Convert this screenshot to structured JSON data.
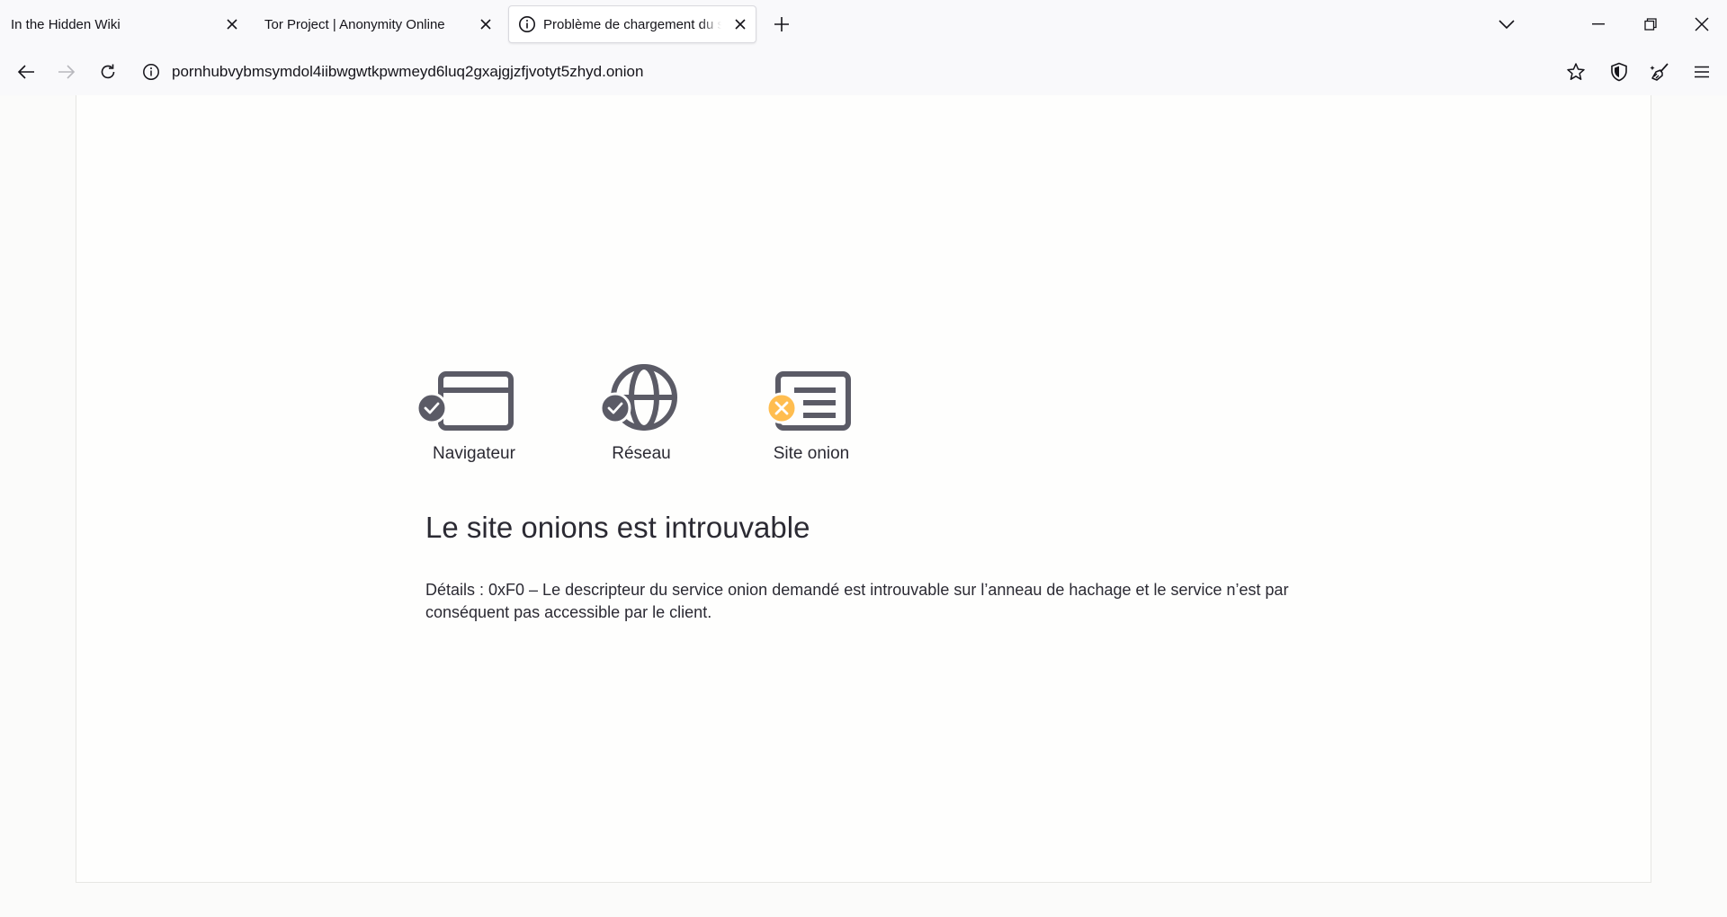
{
  "tabs": [
    {
      "title": "In the Hidden Wiki",
      "active": false
    },
    {
      "title": "Tor Project | Anonymity Online",
      "active": false
    },
    {
      "title": "Problème de chargement du site",
      "active": true
    }
  ],
  "navbar": {
    "url": "pornhubvybmsymdol4iibwgwtkpwmeyd6luq2gxajgjzfjvotyt5zhyd.onion"
  },
  "status_steps": [
    {
      "label": "Navigateur",
      "icon": "browser-icon",
      "status": "ok"
    },
    {
      "label": "Réseau",
      "icon": "globe-icon",
      "status": "ok"
    },
    {
      "label": "Site onion",
      "icon": "onion-site-icon",
      "status": "error"
    }
  ],
  "error": {
    "heading": "Le site onions est introuvable",
    "details": "Détails : 0xF0 – Le descripteur du service onion demandé est introuvable sur l’anneau de hachage et le service n’est par conséquent pas accessible par le client."
  },
  "colors": {
    "ok_badge": "#5b5b66",
    "error_badge": "#ffbd4f",
    "icon_gray": "#5b5b66"
  }
}
